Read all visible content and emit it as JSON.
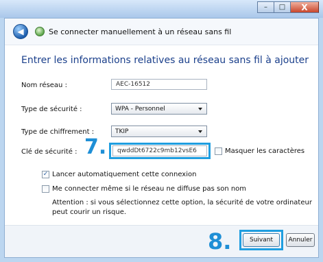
{
  "window": {
    "controls": {
      "minimize": "–",
      "maximize": "□",
      "close": "X"
    }
  },
  "header": {
    "back_icon": "back-arrow-icon",
    "network_icon": "wireless-network-icon",
    "title": "Se connecter manuellement à un réseau sans fil"
  },
  "form": {
    "heading": "Entrer les informations relatives au réseau sans fil à ajouter",
    "network_name": {
      "label": "Nom réseau :",
      "value": "AEC-16512"
    },
    "security_type": {
      "label": "Type de sécurité :",
      "value": "WPA - Personnel"
    },
    "encryption_type": {
      "label": "Type de chiffrement :",
      "value": "TKIP"
    },
    "security_key": {
      "label": "Clé de sécurité :",
      "value": "qwddDt6722c9mb12vsE6"
    },
    "hide_chars": {
      "label": "Masquer les caractères",
      "checked": false
    },
    "auto_connect": {
      "label": "Lancer automatiquement cette connexion",
      "checked": true
    },
    "connect_hidden": {
      "label": "Me connecter même si le réseau ne diffuse pas son nom",
      "checked": false
    },
    "warning": "Attention : si vous sélectionnez cette option, la sécurité de votre ordinateur peut courir un risque."
  },
  "annotations": {
    "step7": "7.",
    "step8": "8.",
    "highlight_color": "#1f9ee0"
  },
  "footer": {
    "next_label": "Suivant",
    "cancel_label": "Annuler"
  }
}
